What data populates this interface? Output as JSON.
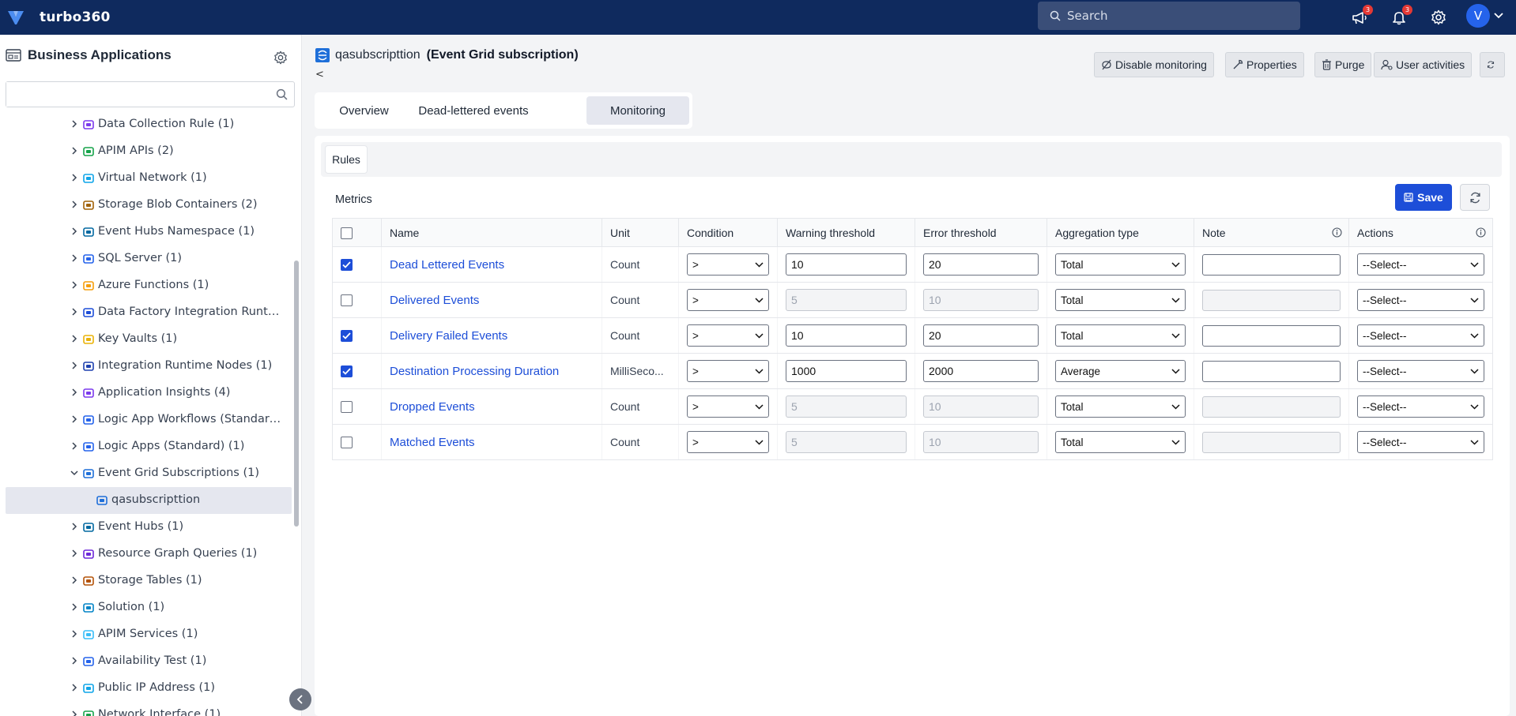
{
  "brand": {
    "name": "turbo360"
  },
  "top": {
    "search_placeholder": "Search",
    "announcements_count": "3",
    "notifications_count": "3",
    "avatar_initial": "V"
  },
  "sidebar": {
    "title": "Business Applications",
    "search_value": "",
    "items": [
      {
        "label": "Data Collection Rule (1)",
        "icon": "location-pin-icon",
        "expanded": false
      },
      {
        "label": "APIM APIs (2)",
        "icon": "api-icon",
        "expanded": false
      },
      {
        "label": "Virtual Network (1)",
        "icon": "network-icon",
        "expanded": false
      },
      {
        "label": "Storage Blob Containers (2)",
        "icon": "storage-icon",
        "expanded": false
      },
      {
        "label": "Event Hubs Namespace (1)",
        "icon": "event-hubs-icon",
        "expanded": false
      },
      {
        "label": "SQL Server (1)",
        "icon": "sql-server-icon",
        "expanded": false
      },
      {
        "label": "Azure Functions (1)",
        "icon": "functions-icon",
        "expanded": false
      },
      {
        "label": "Data Factory Integration Runti...",
        "icon": "data-factory-icon",
        "expanded": false
      },
      {
        "label": "Key Vaults (1)",
        "icon": "key-vault-icon",
        "expanded": false
      },
      {
        "label": "Integration Runtime Nodes (1)",
        "icon": "runtime-nodes-icon",
        "expanded": false
      },
      {
        "label": "Application Insights (4)",
        "icon": "insights-icon",
        "expanded": false
      },
      {
        "label": "Logic App Workflows (Standard...",
        "icon": "logic-app-icon",
        "expanded": false
      },
      {
        "label": "Logic Apps (Standard) (1)",
        "icon": "logic-app-icon",
        "expanded": false
      },
      {
        "label": "Event Grid Subscriptions (1)",
        "icon": "event-grid-icon",
        "expanded": true
      },
      {
        "label": "qasubscripttion",
        "icon": "event-grid-icon",
        "child": true,
        "selected": true
      },
      {
        "label": "Event Hubs (1)",
        "icon": "event-hubs-icon",
        "expanded": false
      },
      {
        "label": "Resource Graph Queries (1)",
        "icon": "graph-query-icon",
        "expanded": false
      },
      {
        "label": "Storage Tables (1)",
        "icon": "table-icon",
        "expanded": false
      },
      {
        "label": "Solution (1)",
        "icon": "solution-icon",
        "expanded": false
      },
      {
        "label": "APIM Services (1)",
        "icon": "cloud-icon",
        "expanded": false
      },
      {
        "label": "Availability Test (1)",
        "icon": "availability-icon",
        "expanded": false
      },
      {
        "label": "Public IP Address (1)",
        "icon": "ip-icon",
        "expanded": false
      },
      {
        "label": "Network Interface (1)",
        "icon": "nic-icon",
        "expanded": false
      }
    ]
  },
  "resource": {
    "name": "qasubscripttion",
    "type": "(Event Grid subscription)",
    "back": "<"
  },
  "actions": {
    "disable_monitoring": "Disable monitoring",
    "properties": "Properties",
    "purge": "Purge",
    "user_activities": "User activities"
  },
  "tabs": [
    {
      "label": "Overview",
      "active": false
    },
    {
      "label": "Dead-lettered events",
      "active": false
    },
    {
      "label": "Monitoring",
      "active": true
    }
  ],
  "monitoring": {
    "rules_tab": "Rules",
    "metrics_label": "Metrics",
    "save_label": "Save",
    "columns": {
      "name": "Name",
      "unit": "Unit",
      "condition": "Condition",
      "warning": "Warning threshold",
      "error": "Error threshold",
      "aggregation": "Aggregation type",
      "note": "Note",
      "actions": "Actions"
    },
    "rows": [
      {
        "checked": true,
        "name": "Dead Lettered Events",
        "unit": "Count",
        "condition": ">",
        "warning": "10",
        "error": "20",
        "aggregation": "Total",
        "note": "",
        "action": "--Select--"
      },
      {
        "checked": false,
        "name": "Delivered Events",
        "unit": "Count",
        "condition": ">",
        "warning": "5",
        "error": "10",
        "aggregation": "Total",
        "note": "",
        "action": "--Select--"
      },
      {
        "checked": true,
        "name": "Delivery Failed Events",
        "unit": "Count",
        "condition": ">",
        "warning": "10",
        "error": "20",
        "aggregation": "Total",
        "note": "",
        "action": "--Select--"
      },
      {
        "checked": true,
        "name": "Destination Processing Duration",
        "unit": "MilliSeco...",
        "condition": ">",
        "warning": "1000",
        "error": "2000",
        "aggregation": "Average",
        "note": "",
        "action": "--Select--"
      },
      {
        "checked": false,
        "name": "Dropped Events",
        "unit": "Count",
        "condition": ">",
        "warning": "5",
        "error": "10",
        "aggregation": "Total",
        "note": "",
        "action": "--Select--"
      },
      {
        "checked": false,
        "name": "Matched Events",
        "unit": "Count",
        "condition": ">",
        "warning": "5",
        "error": "10",
        "aggregation": "Total",
        "note": "",
        "action": "--Select--"
      }
    ]
  },
  "colors": {
    "topbar": "#0f2a5e",
    "accent": "#1d4ed8",
    "link": "#1d4ed8",
    "badge": "#e53935"
  }
}
